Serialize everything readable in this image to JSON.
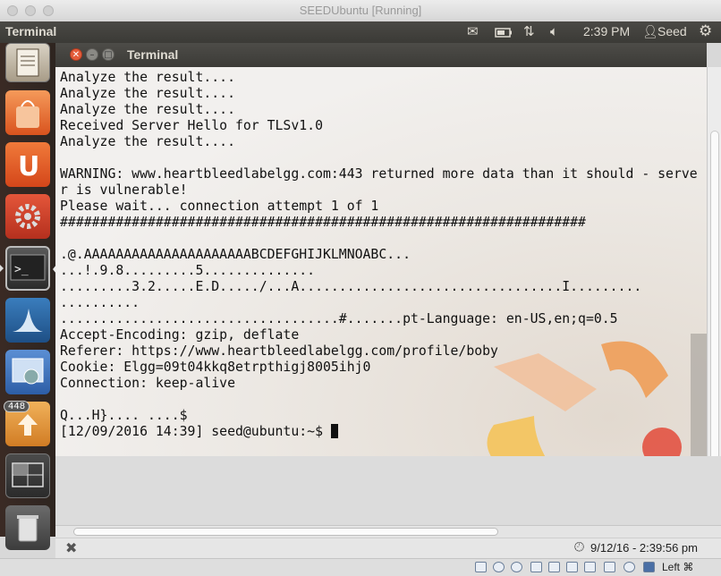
{
  "host_window": {
    "title": "SEEDUbuntu [Running]"
  },
  "top_panel": {
    "app_name": "Terminal",
    "icons": [
      "mail-icon",
      "battery-icon",
      "network-icon",
      "volume-icon",
      "gear-icon"
    ],
    "clock": "2:39 PM",
    "user": "Seed"
  },
  "launcher": {
    "badge_count": "448",
    "items": [
      "text-editor-icon",
      "shopping-bag-icon",
      "ubuntu-one-icon",
      "system-settings-icon",
      "terminal-icon",
      "wireshark-icon",
      "screenshot-icon",
      "file-transfer-icon",
      "workspace-switcher-icon",
      "trash-icon"
    ]
  },
  "terminal": {
    "title": "Terminal",
    "output": "Analyze the result....\nAnalyze the result....\nAnalyze the result....\nReceived Server Hello for TLSv1.0\nAnalyze the result....\n\nWARNING: www.heartbleedlabelgg.com:443 returned more data than it should - serve\nr is vulnerable!\nPlease wait... connection attempt 1 of 1\n##################################################################\n\n.@.AAAAAAAAAAAAAAAAAAAAABCDEFGHIJKLMNOABC...\n...!.9.8.........5..............\n.........3.2.....E.D...../...A.................................I.........\n..........\n...................................#.......pt-Language: en-US,en;q=0.5\nAccept-Encoding: gzip, deflate\nReferer: https://www.heartbleedlabelgg.com/profile/boby\nCookie: Elgg=09t04kkq8etrpthigj8005ihj0\nConnection: keep-alive\n\nQ...H}.... ....$\n",
    "prompt": "[12/09/2016 14:39] seed@ubuntu:~$ "
  },
  "status": {
    "datetime": "9/12/16 - 2:39:56 pm"
  },
  "bottom_bar": {
    "host_key": "Left ⌘"
  }
}
